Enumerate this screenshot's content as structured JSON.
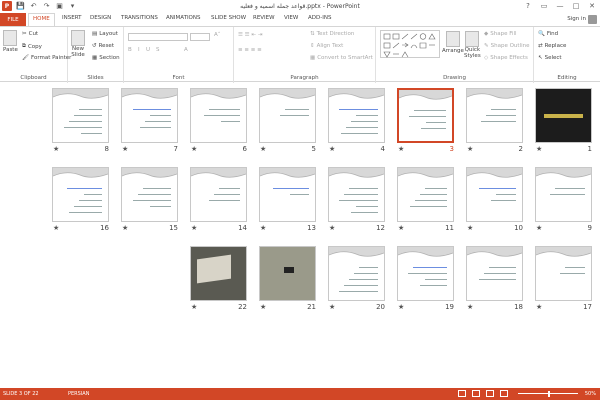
{
  "window": {
    "title": "قواعد جمله اسمیه و فعلیه.pptx - PowerPoint",
    "app_icon": "P",
    "controls": [
      "?",
      "▭",
      "—",
      "□",
      "✕"
    ]
  },
  "tabs": [
    {
      "label": "FILE",
      "file": true
    },
    {
      "label": "HOME",
      "active": true
    },
    {
      "label": "INSERT"
    },
    {
      "label": "DESIGN"
    },
    {
      "label": "TRANSITIONS"
    },
    {
      "label": "ANIMATIONS"
    },
    {
      "label": "SLIDE SHOW"
    },
    {
      "label": "REVIEW"
    },
    {
      "label": "VIEW"
    },
    {
      "label": "ADD-INS"
    }
  ],
  "signin": "Sign in",
  "ribbon": {
    "clipboard": {
      "label": "Clipboard",
      "paste": "Paste",
      "cut": "Cut",
      "copy": "Copy",
      "format_painter": "Format Painter"
    },
    "slides": {
      "label": "Slides",
      "new_slide": "New",
      "new_slide2": "Slide",
      "layout": "Layout",
      "reset": "Reset",
      "section": "Section"
    },
    "font": {
      "label": "Font"
    },
    "paragraph": {
      "label": "Paragraph",
      "text_direction": "Text Direction",
      "align_text": "Align Text",
      "smartart": "Convert to SmartArt"
    },
    "drawing": {
      "label": "Drawing",
      "arrange": "Arrange",
      "quick": "Quick",
      "styles": "Styles",
      "shape_fill": "Shape Fill",
      "shape_outline": "Shape Outline",
      "shape_effects": "Shape Effects"
    },
    "editing": {
      "label": "Editing",
      "find": "Find",
      "replace": "Replace",
      "select": "Select"
    }
  },
  "slides": [
    {
      "n": "1",
      "kind": "dark"
    },
    {
      "n": "2",
      "kind": "plain"
    },
    {
      "n": "3",
      "kind": "plain",
      "selected": true
    },
    {
      "n": "4",
      "kind": "plain"
    },
    {
      "n": "5",
      "kind": "plain"
    },
    {
      "n": "6",
      "kind": "plain"
    },
    {
      "n": "7",
      "kind": "plain"
    },
    {
      "n": "8",
      "kind": "plain"
    },
    {
      "n": "9",
      "kind": "plain"
    },
    {
      "n": "10",
      "kind": "plain"
    },
    {
      "n": "11",
      "kind": "plain"
    },
    {
      "n": "12",
      "kind": "plain"
    },
    {
      "n": "13",
      "kind": "plain"
    },
    {
      "n": "14",
      "kind": "plain"
    },
    {
      "n": "15",
      "kind": "plain"
    },
    {
      "n": "16",
      "kind": "plain"
    },
    {
      "n": "17",
      "kind": "plain"
    },
    {
      "n": "18",
      "kind": "plain"
    },
    {
      "n": "19",
      "kind": "plain"
    },
    {
      "n": "20",
      "kind": "plain"
    },
    {
      "n": "21",
      "kind": "gray"
    },
    {
      "n": "22",
      "kind": "photo"
    }
  ],
  "status": {
    "slide": "SLIDE 3 OF 22",
    "language": "PERSIAN",
    "zoom": "50%"
  },
  "colors": {
    "accent": "#d24726"
  }
}
